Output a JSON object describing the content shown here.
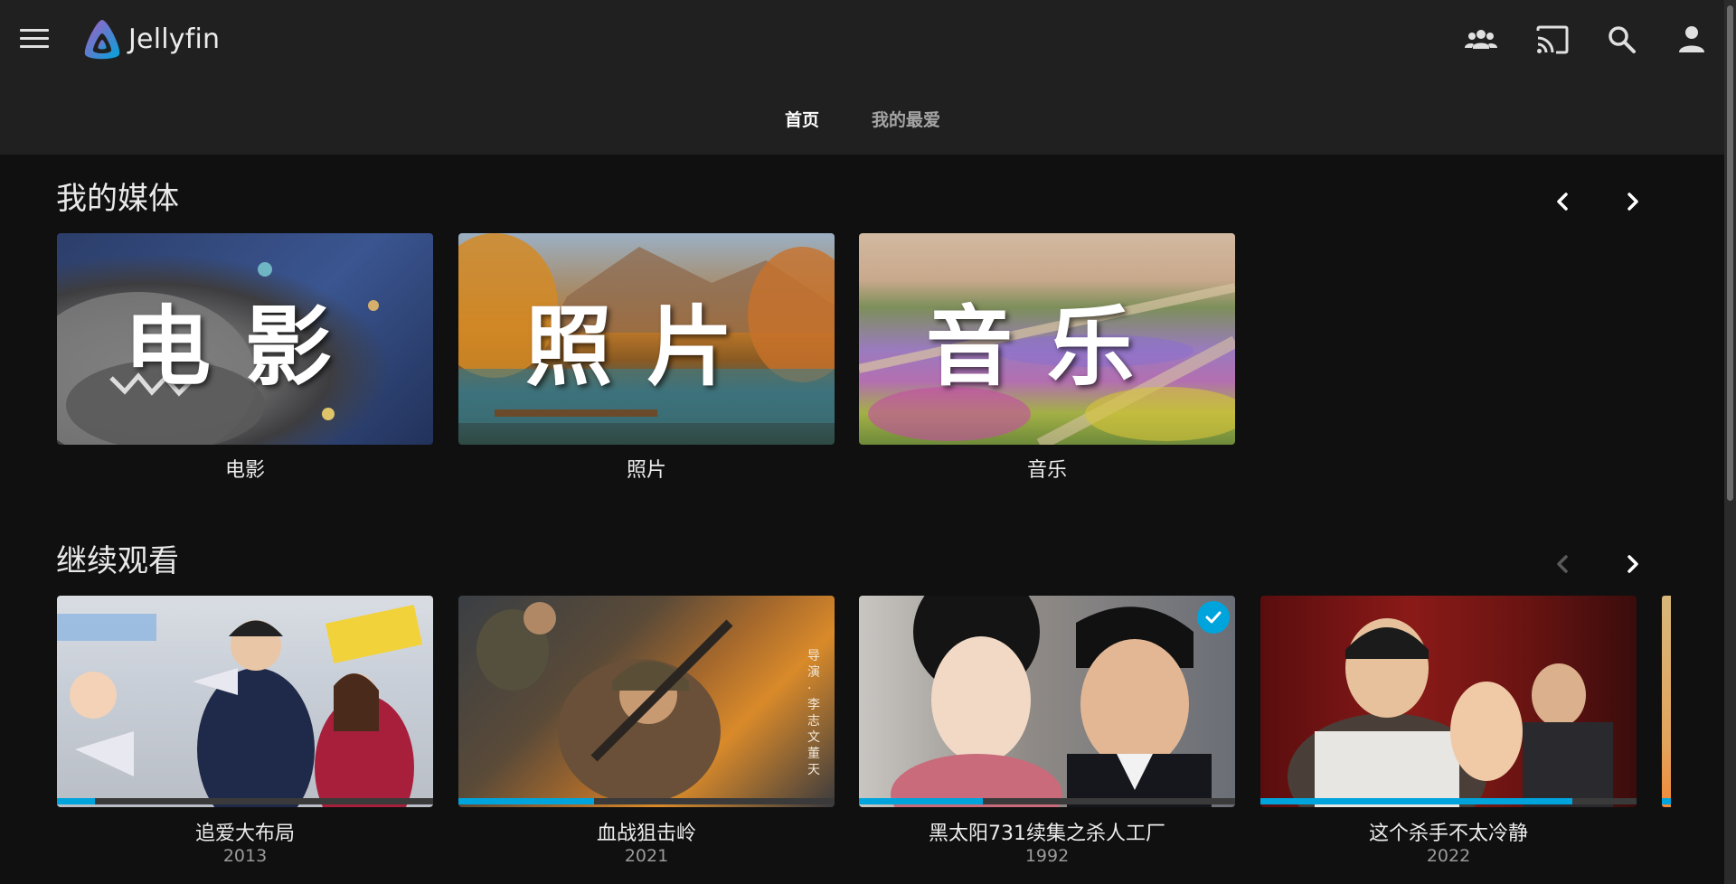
{
  "app": {
    "brand": "Jellyfin",
    "accent_color": "#00a4dc"
  },
  "header": {
    "menu_icon": "hamburger-menu-icon",
    "right_icons": [
      "users-group-icon",
      "cast-icon",
      "search-icon",
      "user-account-icon"
    ]
  },
  "tabs": [
    {
      "label": "首页",
      "active": true
    },
    {
      "label": "我的最爱",
      "active": false
    }
  ],
  "sections": {
    "my_media": {
      "title": "我的媒体",
      "items": [
        {
          "label": "电影",
          "overlay": "电影",
          "art": "movie-library-art"
        },
        {
          "label": "照片",
          "overlay": "照片",
          "art": "photos-library-art"
        },
        {
          "label": "音乐",
          "overlay": "音乐",
          "art": "music-library-art"
        }
      ]
    },
    "continue_watching": {
      "title": "继续观看",
      "items": [
        {
          "label": "追爱大布局",
          "year": "2013",
          "progress": 0.1,
          "watched": false
        },
        {
          "label": "血战狙击岭",
          "year": "2021",
          "progress": 0.36,
          "watched": false,
          "poster_text": "导演 · 李志文 董天"
        },
        {
          "label": "黑太阳731续集之杀人工厂",
          "year": "1992",
          "progress": 0.33,
          "watched": true
        },
        {
          "label": "这个杀手不太冷静",
          "year": "2022",
          "progress": 0.83,
          "watched": false
        }
      ]
    }
  }
}
